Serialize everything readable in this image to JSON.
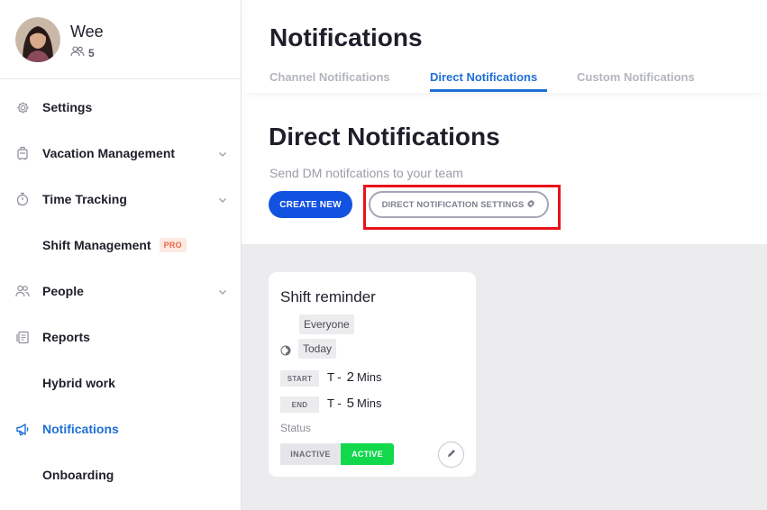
{
  "user": {
    "name": "Wee",
    "member_count": "5"
  },
  "sidebar": {
    "items": [
      {
        "label": "Settings",
        "icon": "gear-icon"
      },
      {
        "label": "Vacation Management",
        "icon": "luggage-icon"
      },
      {
        "label": "Time Tracking",
        "icon": "stopwatch-icon"
      },
      {
        "label": "Shift Management",
        "badge": "PRO"
      },
      {
        "label": "People",
        "icon": "people-icon"
      },
      {
        "label": "Reports",
        "icon": "reports-icon"
      },
      {
        "label": "Hybrid work"
      },
      {
        "label": "Notifications",
        "icon": "megaphone-icon"
      },
      {
        "label": "Onboarding"
      }
    ]
  },
  "header": {
    "title": "Notifications",
    "tabs": [
      {
        "label": "Channel Notifications"
      },
      {
        "label": "Direct Notifications"
      },
      {
        "label": "Custom Notifications"
      }
    ]
  },
  "main": {
    "title": "Direct Notifications",
    "subtitle": "Send DM notifcations to your team",
    "create_button": "CREATE NEW",
    "settings_button": "DIRECT NOTIFICATION SETTINGS"
  },
  "card": {
    "title": "Shift reminder",
    "audience": "Everyone",
    "day": "Today",
    "start_label": "START",
    "start_prefix": "T -",
    "start_value": "2",
    "start_unit": "Mins",
    "end_label": "END",
    "end_prefix": "T -",
    "end_value": "5",
    "end_unit": "Mins",
    "status_label": "Status",
    "inactive_label": "INACTIVE",
    "active_label": "ACTIVE"
  },
  "colors": {
    "accent": "#1f6fd6",
    "primary_button": "#1152e0",
    "active_toggle": "#12d84c",
    "highlight": "#e8121a",
    "pro_badge": "#e8694a"
  }
}
